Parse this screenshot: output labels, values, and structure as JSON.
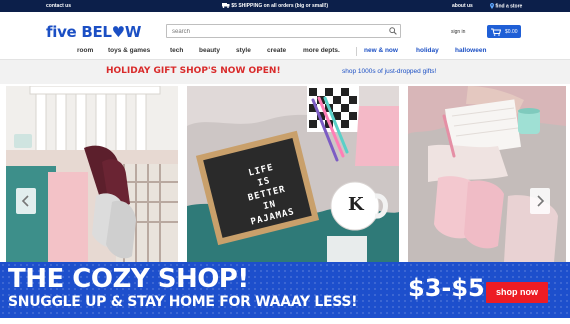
{
  "topbar": {
    "contact": "contact us",
    "shipping": "$5 SHIPPING on all orders (big or small!)",
    "about": "about us",
    "find_store": "find a store"
  },
  "header": {
    "logo": "five BEL♥W",
    "search_placeholder": "search",
    "signin": "sign in",
    "cart_amount": "$0.00"
  },
  "nav": {
    "items": [
      "room",
      "toys & games",
      "tech",
      "beauty",
      "style",
      "create",
      "more depts."
    ],
    "highlight_items": [
      "new & now",
      "holiday",
      "halloween"
    ]
  },
  "promo": {
    "headline": "HOLIDAY GIFT SHOP'S NOW OPEN!",
    "link": "shop 1000s of just-dropped gifts!"
  },
  "hero": {
    "letterboard": [
      "LIFE",
      "IS",
      "BETTER",
      "IN",
      "PAJAMAS"
    ],
    "mug_letter": "K",
    "banner_headline": "THE COZY SHOP!",
    "banner_sub": "SNUGGLE UP & STAY HOME FOR WAAAY LESS!",
    "price": "$3-$5",
    "shop_now": "shop now"
  },
  "colors": {
    "brand_blue": "#1b4fc4",
    "topbar": "#0c1f4a",
    "promo_red": "#d92b2b",
    "cta_red": "#ed1c24"
  }
}
